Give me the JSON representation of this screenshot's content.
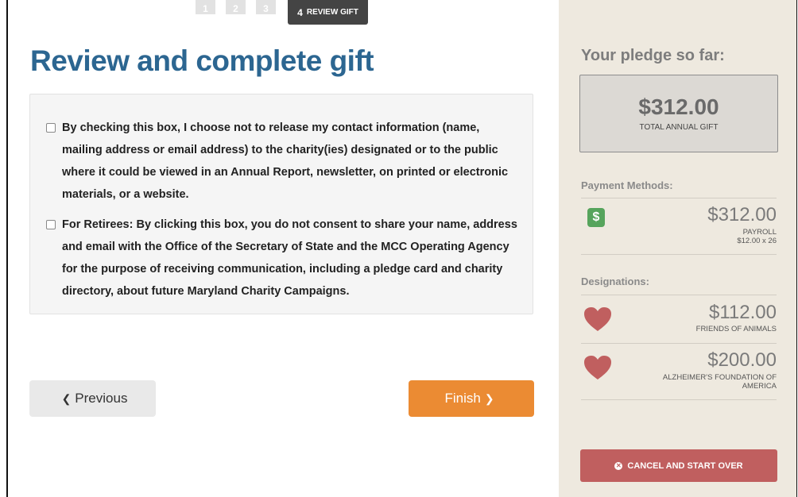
{
  "steps": {
    "inactive": [
      "1",
      "2",
      "3"
    ],
    "active_number": "4",
    "active_label": "REVIEW GIFT"
  },
  "page_title": "Review and complete gift",
  "consents": [
    {
      "text": "By checking this box, I choose not to release my contact information (name, mailing address or email address) to the charity(ies) designated or to the public where it could be viewed in an Annual Report, newsletter, on printed or electronic materials, or a website."
    },
    {
      "text": "For Retirees: By clicking this box, you do not consent to share your name, address and email with the Office of the Secretary of State and the MCC Operating Agency for the purpose of receiving communication, including a pledge card and charity directory, about future Maryland Charity Campaigns."
    }
  ],
  "buttons": {
    "previous": "Previous",
    "finish": "Finish"
  },
  "sidebar": {
    "title": "Your pledge so far:",
    "total_amount": "$312.00",
    "total_label": "TOTAL ANNUAL GIFT",
    "payment_label": "Payment Methods:",
    "payment": {
      "icon": "dollar-icon",
      "icon_glyph": "$",
      "amount": "$312.00",
      "method": "PAYROLL",
      "detail": "$12.00 x 26"
    },
    "designations_label": "Designations:",
    "designations": [
      {
        "amount": "$112.00",
        "name": "FRIENDS OF ANIMALS"
      },
      {
        "amount": "$200.00",
        "name": "ALZHEIMER'S FOUNDATION OF AMERICA"
      }
    ],
    "cancel_label": "CANCEL AND START OVER"
  },
  "colors": {
    "title_blue": "#2c6691",
    "finish_orange": "#eb8b33",
    "cancel_red": "#c05f5f",
    "heart_red": "#c05f5f",
    "dollar_green": "#56a45c",
    "sidebar_bg": "#eee9df"
  }
}
